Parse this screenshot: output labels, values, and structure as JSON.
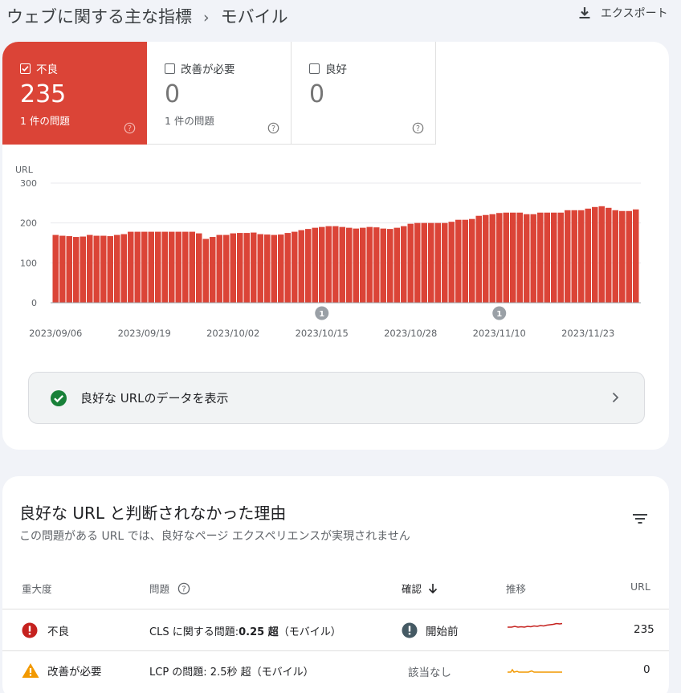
{
  "header": {
    "breadcrumb_root": "ウェブに関する主な指標",
    "breadcrumb_current": "モバイル",
    "export_label": "エクスポート"
  },
  "tiles": [
    {
      "label": "不良",
      "value": "235",
      "sub": "1 件の問題",
      "active": true
    },
    {
      "label": "改善が必要",
      "value": "0",
      "sub": "1 件の問題",
      "active": false
    },
    {
      "label": "良好",
      "value": "0",
      "sub": "",
      "active": false
    }
  ],
  "chart_data": {
    "type": "bar",
    "ylabel": "URL",
    "ylim": [
      0,
      300
    ],
    "yticks": [
      0,
      100,
      200,
      300
    ],
    "x_tick_labels": [
      "2023/09/06",
      "2023/09/19",
      "2023/10/02",
      "2023/10/15",
      "2023/10/28",
      "2023/11/10",
      "2023/11/23"
    ],
    "start_date": "2023/09/06",
    "values": [
      170,
      168,
      167,
      165,
      166,
      170,
      168,
      168,
      167,
      170,
      172,
      178,
      178,
      178,
      178,
      178,
      178,
      178,
      178,
      178,
      178,
      174,
      160,
      165,
      170,
      170,
      174,
      175,
      175,
      176,
      172,
      171,
      170,
      171,
      175,
      178,
      182,
      185,
      188,
      190,
      192,
      192,
      190,
      188,
      186,
      188,
      190,
      189,
      186,
      185,
      188,
      192,
      198,
      200,
      200,
      200,
      200,
      200,
      203,
      208,
      208,
      210,
      218,
      220,
      222,
      225,
      226,
      226,
      226,
      222,
      222,
      226,
      226,
      226,
      226,
      232,
      232,
      232,
      236,
      240,
      242,
      238,
      232,
      230,
      230,
      234
    ],
    "color": "#db4437",
    "annotations": [
      {
        "date": "2023/10/15",
        "label": "1"
      },
      {
        "date": "2023/11/10",
        "label": "1"
      }
    ]
  },
  "good_link": {
    "label": "良好な URLのデータを表示"
  },
  "issues": {
    "title": "良好な URL と判断されなかった理由",
    "subtitle": "この問題がある URL では、良好なページ エクスペリエンスが実現されません",
    "columns": {
      "severity": "重大度",
      "issue": "問題",
      "validation": "確認",
      "trend": "推移",
      "url": "URL"
    },
    "rows": [
      {
        "severity": "不良",
        "issue_prefix": "CLS に関する問題: ",
        "issue_value": "0.25 超",
        "issue_suffix": "（モバイル）",
        "validation": "開始前",
        "count": "235",
        "severity_color": "#c5221f"
      },
      {
        "severity": "改善が必要",
        "issue_prefix": "LCP の問題: 2.5秒 超（モバイル）",
        "issue_value": "",
        "issue_suffix": "",
        "validation": "該当なし",
        "count": "0",
        "severity_color": "#f29900"
      }
    ]
  }
}
